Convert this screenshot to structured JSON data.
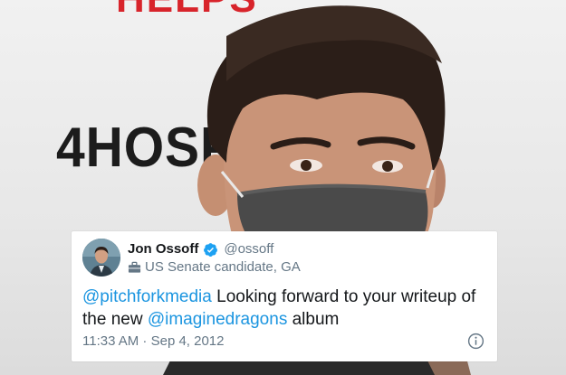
{
  "background": {
    "banner_top_text": "HELPS",
    "banner_mid_text": "4HOSP"
  },
  "tweet": {
    "author_name": "Jon Ossoff",
    "verified": true,
    "handle": "@ossoff",
    "bio": "US Senate candidate, GA",
    "body_parts": [
      {
        "text": "@pitchforkmedia",
        "mention": true
      },
      {
        "text": " Looking forward to your writeup of the new ",
        "mention": false
      },
      {
        "text": "@imaginedragons",
        "mention": true
      },
      {
        "text": " album",
        "mention": false
      }
    ],
    "timestamp": "11:33 AM · Sep 4, 2012",
    "icons": {
      "verified": "verified-badge-icon",
      "bio": "briefcase-icon",
      "info": "info-icon"
    },
    "colors": {
      "mention": "#1b95e0",
      "verified": "#1da1f2",
      "secondary_text": "#657786",
      "primary_text": "#14171a"
    }
  }
}
